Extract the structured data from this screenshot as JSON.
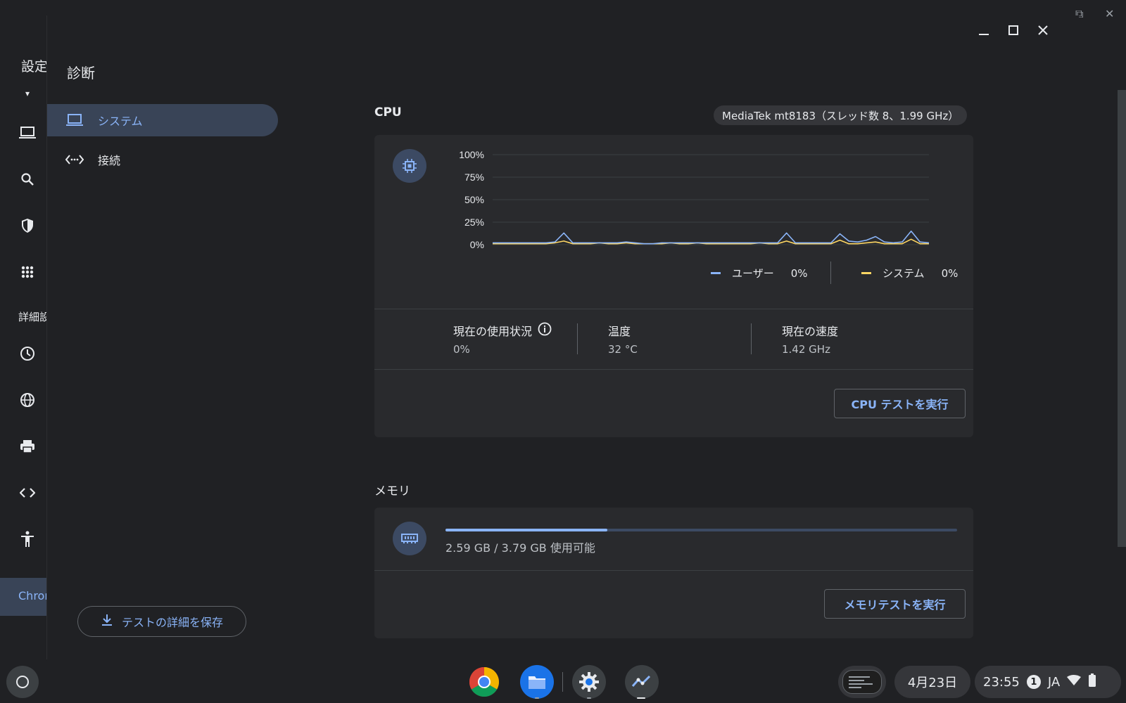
{
  "background_app": {
    "title": "設定",
    "advanced_label": "詳細設",
    "chrome_label": "Chrome"
  },
  "window": {
    "app_title": "診断",
    "nav": [
      {
        "label": "システム",
        "icon": "laptop-icon",
        "active": true
      },
      {
        "label": "接続",
        "icon": "connectivity-icon",
        "active": false
      }
    ],
    "save_button_label": "テストの詳細を保存"
  },
  "cpu": {
    "section_title": "CPU",
    "chip": "MediaTek mt8183（スレッド数 8、1.99 GHz）",
    "legend": [
      {
        "name": "ユーザー",
        "value": "0%",
        "color": "#8ab4f8"
      },
      {
        "name": "システム",
        "value": "0%",
        "color": "#fdd663"
      }
    ],
    "stats": [
      {
        "label": "現在の使用状況",
        "value": "0%"
      },
      {
        "label": "温度",
        "value": "32 °C"
      },
      {
        "label": "現在の速度",
        "value": "1.42 GHz"
      }
    ],
    "run_button": "CPU テストを実行"
  },
  "chart_data": {
    "type": "line",
    "title": "",
    "xlabel": "",
    "ylabel": "",
    "ylim": [
      0,
      100
    ],
    "y_ticks": [
      "100%",
      "75%",
      "50%",
      "25%",
      "0%"
    ],
    "grid": true,
    "legend_position": "bottom-right",
    "x": [
      0,
      1,
      2,
      3,
      4,
      5,
      6,
      7,
      8,
      9,
      10,
      11,
      12,
      13,
      14,
      15,
      16,
      17,
      18,
      19,
      20,
      21,
      22,
      23,
      24,
      25,
      26,
      27,
      28,
      29,
      30,
      31,
      32,
      33,
      34,
      35,
      36,
      37,
      38,
      39,
      40,
      41,
      42,
      43,
      44,
      45,
      46,
      47,
      48,
      49
    ],
    "series": [
      {
        "name": "ユーザー",
        "color": "#8ab4f8",
        "values": [
          2,
          2,
          2,
          2,
          2,
          2,
          2,
          3,
          13,
          2,
          2,
          2,
          2,
          2,
          2,
          3,
          2,
          1,
          1,
          2,
          2,
          2,
          2,
          2,
          2,
          2,
          2,
          2,
          2,
          2,
          2,
          2,
          2,
          13,
          2,
          2,
          2,
          2,
          2,
          12,
          4,
          3,
          5,
          9,
          3,
          2,
          3,
          15,
          3,
          2
        ]
      },
      {
        "name": "システム",
        "color": "#fdd663",
        "values": [
          1,
          1,
          1,
          1,
          1,
          1,
          1,
          2,
          4,
          1,
          1,
          1,
          2,
          1,
          1,
          2,
          1,
          1,
          1,
          1,
          2,
          1,
          1,
          2,
          1,
          1,
          1,
          1,
          1,
          1,
          2,
          1,
          1,
          4,
          1,
          1,
          1,
          1,
          1,
          5,
          1,
          1,
          2,
          3,
          1,
          1,
          1,
          6,
          1,
          1
        ]
      }
    ]
  },
  "memory": {
    "section_title": "メモリ",
    "usage_text": "2.59 GB / 3.79 GB 使用可能",
    "used_fraction": 0.317,
    "run_button": "メモリテストを実行"
  },
  "shelf": {
    "date": "4月23日",
    "time": "23:55",
    "notification_count": "1",
    "ime": "JA"
  }
}
